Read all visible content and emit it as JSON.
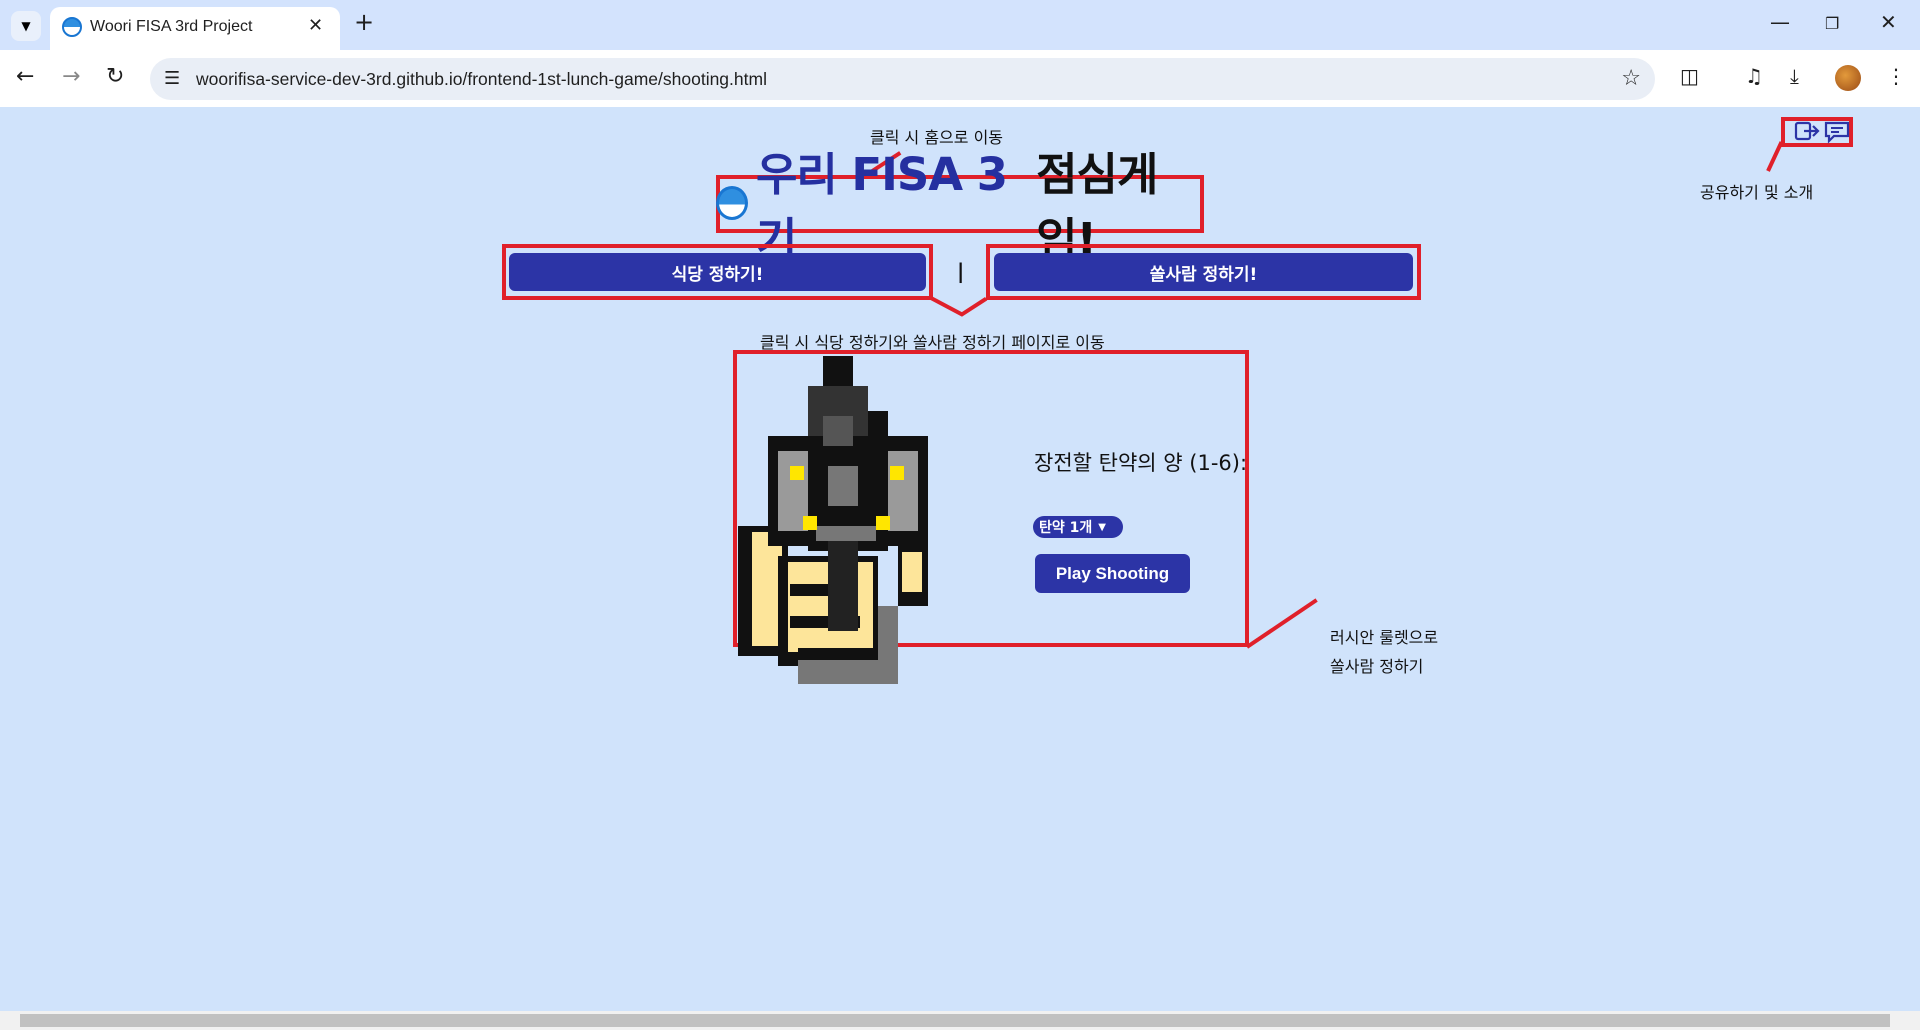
{
  "browser": {
    "tab_title": "Woori FISA 3rd Project",
    "url": "woorifisa-service-dev-3rd.github.io/frontend-1st-lunch-game/shooting.html"
  },
  "header": {
    "title_part1": "우리 FISA 3기",
    "title_part2": "점심게임!",
    "nav_restaurant": "식당 정하기!",
    "nav_separator": "|",
    "nav_payer": "쏠사람 정하기!"
  },
  "annotations": {
    "home": "클릭 시 홈으로 이동",
    "share": "공유하기 및 소개",
    "nav": "클릭 시 식당 정하기와 쏠사람 정하기 페이지로 이동",
    "roulette_line1": "러시안 룰렛으로",
    "roulette_line2": "쏠사람 정하기"
  },
  "game": {
    "ammo_label": "장전할 탄약의 양 (1-6):",
    "ammo_selected": "탄약 1개",
    "play_button": "Play Shooting"
  },
  "colors": {
    "page_bg": "#d0e3fb",
    "accent": "#2c34a6",
    "annotation_red": "#e0202a"
  },
  "icons": [
    "chevron-down-icon",
    "close-icon",
    "plus-icon",
    "minimize-icon",
    "restore-icon",
    "back-icon",
    "forward-icon",
    "reload-icon",
    "site-info-icon",
    "star-icon",
    "extensions-icon",
    "media-icon",
    "download-icon",
    "menu-icon",
    "share-icon",
    "comment-icon"
  ]
}
